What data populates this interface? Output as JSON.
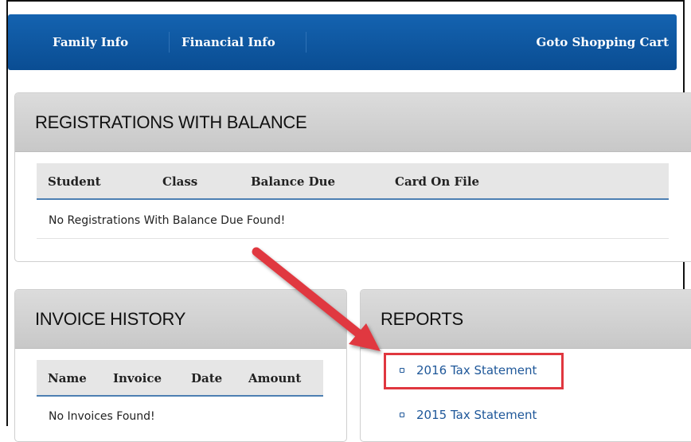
{
  "nav": {
    "items": [
      {
        "label": "Family Info"
      },
      {
        "label": "Financial Info"
      }
    ],
    "cart_label": "Goto Shopping Cart"
  },
  "registrations": {
    "title": "REGISTRATIONS WITH BALANCE",
    "columns": [
      "Student",
      "Class",
      "Balance Due",
      "Card On File"
    ],
    "empty_message": "No Registrations With Balance Due Found!"
  },
  "invoices": {
    "title": "INVOICE HISTORY",
    "columns": [
      "Name",
      "Invoice",
      "Date",
      "Amount"
    ],
    "empty_message": "No Invoices Found!"
  },
  "reports": {
    "title": "REPORTS",
    "links": [
      {
        "label": "2016 Tax Statement"
      },
      {
        "label": "2015 Tax Statement"
      }
    ]
  },
  "annotation": {
    "arrow_color": "#e0373f",
    "highlight_color": "#e0373f"
  }
}
